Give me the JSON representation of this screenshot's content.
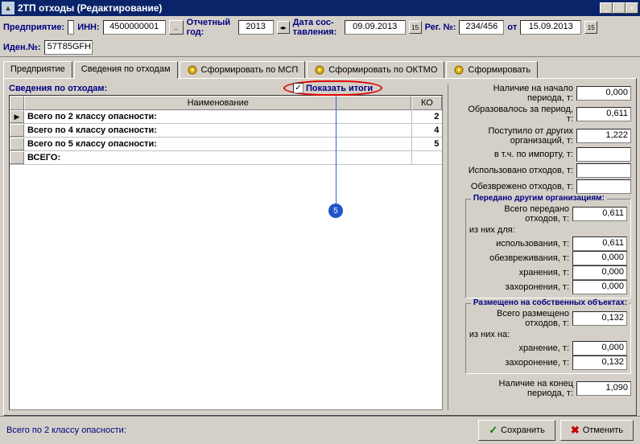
{
  "window": {
    "title": "2ТП отходы (Редактирование)"
  },
  "toolbar": {
    "org_label": "Предприятие:",
    "org_value": "",
    "inn_label": "ИНН:",
    "inn_value": "4500000001",
    "year_label": "Отчетный год:",
    "year_value": "2013",
    "date_label": "Дата сос- тавления:",
    "date_value": "09.09.2013",
    "reg_label": "Рег. №:",
    "reg_value": "234/456",
    "from_label": "от",
    "from_value": "15.09.2013",
    "iden_label": "Иден.№:",
    "iden_value": "57T85GFH"
  },
  "tabs": {
    "t1": "Предприятие",
    "t2": "Сведения по отходам",
    "t3": "Сформировать по МСП",
    "t4": "Сформировать по ОКТМО",
    "t5": "Сформировать"
  },
  "grid": {
    "section_label": "Сведения по отходам:",
    "show_totals": "Показать итоги",
    "col_name": "Наименование",
    "col_ko": "КО",
    "rows": [
      {
        "name": "Всего по 2 классу опасности:",
        "ko": "2"
      },
      {
        "name": "Всего по 4 классу опасности:",
        "ko": "4"
      },
      {
        "name": "Всего по 5 классу опасности:",
        "ko": "5"
      },
      {
        "name": "ВСЕГО:",
        "ko": ""
      }
    ]
  },
  "right": {
    "r1": {
      "lbl": "Наличие на начало периода, т:",
      "val": "0,000"
    },
    "r2": {
      "lbl": "Образовалось за период, т:",
      "val": "0,611"
    },
    "r3": {
      "lbl": "Поступило от других организаций, т:",
      "val": "1,222"
    },
    "r4": {
      "lbl": "в т.ч. по импорту, т:",
      "val": ""
    },
    "r5": {
      "lbl": "Использовано отходов, т:",
      "val": ""
    },
    "r6": {
      "lbl": "Обезврежено отходов, т:",
      "val": ""
    },
    "g1_title": "Передано другим организациям:",
    "g1r1": {
      "lbl": "Всего передано отходов, т:",
      "val": "0,611"
    },
    "g1_sub": "из них для:",
    "g1r2": {
      "lbl": "использования, т:",
      "val": "0,611"
    },
    "g1r3": {
      "lbl": "обезвреживания, т:",
      "val": "0,000"
    },
    "g1r4": {
      "lbl": "хранения, т:",
      "val": "0,000"
    },
    "g1r5": {
      "lbl": "захоронения, т:",
      "val": "0,000"
    },
    "g2_title": "Размещено на собственных объектах:",
    "g2r1": {
      "lbl": "Всего размещено отходов, т:",
      "val": "0,132"
    },
    "g2_sub": "из них на:",
    "g2r2": {
      "lbl": "хранение, т:",
      "val": "0,000"
    },
    "g2r3": {
      "lbl": "захоронение, т:",
      "val": "0,132"
    },
    "r_last": {
      "lbl": "Наличие на конец периода, т:",
      "val": "1,090"
    }
  },
  "footer": {
    "status": "Всего по 2 классу опасности:",
    "save": "Сохранить",
    "cancel": "Отменить"
  },
  "annot": {
    "num": "5"
  }
}
